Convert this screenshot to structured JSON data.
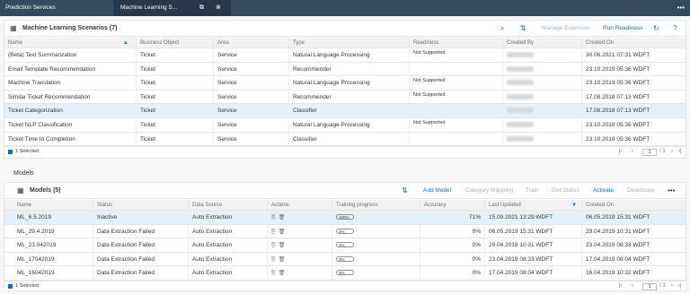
{
  "shell": {
    "tabs": [
      {
        "label": "Prediction Services"
      },
      {
        "label": "Machine Learning S..."
      }
    ],
    "more_label": "•••"
  },
  "scenarios": {
    "title": "Machine Learning Scenarios",
    "count": "(7)",
    "actions": {
      "manage": "Manage Extension",
      "run": "Run Readiness"
    },
    "columns": [
      "Name",
      "Business Object",
      "Area",
      "Type",
      "Readiness",
      "Created By",
      "Created On"
    ],
    "rows": [
      {
        "name": "(Beta) Text Summarization",
        "bo": "Ticket",
        "area": "Service",
        "type": "Natural Language Processing",
        "readiness": "Not Supported",
        "created_on": "30.06.2021 07:31 WDFT"
      },
      {
        "name": "Email Template Recommendation",
        "bo": "Ticket",
        "area": "Service",
        "type": "Recommender",
        "readiness": "",
        "created_on": "23.10.2019 05:36 WDFT"
      },
      {
        "name": "Machine Translation",
        "bo": "Ticket",
        "area": "Service",
        "type": "Natural Language Processing",
        "readiness": "Not Supported",
        "created_on": "23.10.2019 05:36 WDFT"
      },
      {
        "name": "Similar Ticket Recommendation",
        "bo": "Ticket",
        "area": "Service",
        "type": "Recommender",
        "readiness": "Not Supported",
        "created_on": "17.08.2018 07:13 WDFT"
      },
      {
        "name": "Ticket Categorization",
        "bo": "Ticket",
        "area": "Service",
        "type": "Classifier",
        "readiness": "",
        "created_on": "17.08.2018 07:13 WDFT"
      },
      {
        "name": "Ticket NLP Classification",
        "bo": "Ticket",
        "area": "Service",
        "type": "Natural Language Processing",
        "readiness": "Not Supported",
        "created_on": "23.10.2019 05:36 WDFT"
      },
      {
        "name": "Ticket Time to Completion",
        "bo": "Ticket",
        "area": "Service",
        "type": "Classifier",
        "readiness": "",
        "created_on": "23.10.2019 05:36 WDFT"
      }
    ],
    "selected_text": "1 Selected",
    "pager": {
      "page": "1",
      "total": "/ 1"
    }
  },
  "models_section_label": "Models",
  "models": {
    "title": "Models",
    "count": "(5)",
    "actions": {
      "add": "Add Model",
      "category": "Category Mapping",
      "train": "Train",
      "status": "Get Status",
      "activate": "Activate",
      "deactivate": "Deactivate"
    },
    "columns": [
      "Name",
      "Status",
      "Data Source",
      "Actions",
      "Training progress",
      "Accuracy",
      "Last Updated",
      "Created On"
    ],
    "rows": [
      {
        "name": "ML_6.5.2019",
        "status": "Inactive",
        "source": "Auto Extraction",
        "progress": "100%",
        "accuracy": "71%",
        "updated": "15.09.2021 13:29 WDFT",
        "created": "06.05.2019 15:31 WDFT"
      },
      {
        "name": "ML_29.4.2019",
        "status": "Data Extraction Failed",
        "source": "Auto Extraction",
        "progress": "0%",
        "accuracy": "0%",
        "updated": "06.05.2019 15:31 WDFT",
        "created": "29.04.2019 10:31 WDFT"
      },
      {
        "name": "ML_23.042019",
        "status": "Data Extraction Failed",
        "source": "Auto Extraction",
        "progress": "0%",
        "accuracy": "0%",
        "updated": "29.04.2019 10:31 WDFT",
        "created": "23.04.2019 08:33 WDFT"
      },
      {
        "name": "ML_17042019",
        "status": "Data Extraction Failed",
        "source": "Auto Extraction",
        "progress": "0%",
        "accuracy": "0%",
        "updated": "23.04.2019 08:33 WDFT",
        "created": "17.04.2019 08:04 WDFT"
      },
      {
        "name": "ML_16042019",
        "status": "Data Extraction Failed",
        "source": "Auto Extraction",
        "progress": "0%",
        "accuracy": "0%",
        "updated": "17.04.2019 08:04 WDFT",
        "created": "16.04.2019 10:32 WDFT"
      }
    ],
    "selected_text": "1 Selected",
    "pager": {
      "page": "1",
      "total": "/ 1"
    }
  },
  "colors": {
    "shell": "#354a5f",
    "accent": "#0a6ed1",
    "selected_row": "#e5f0fa"
  }
}
